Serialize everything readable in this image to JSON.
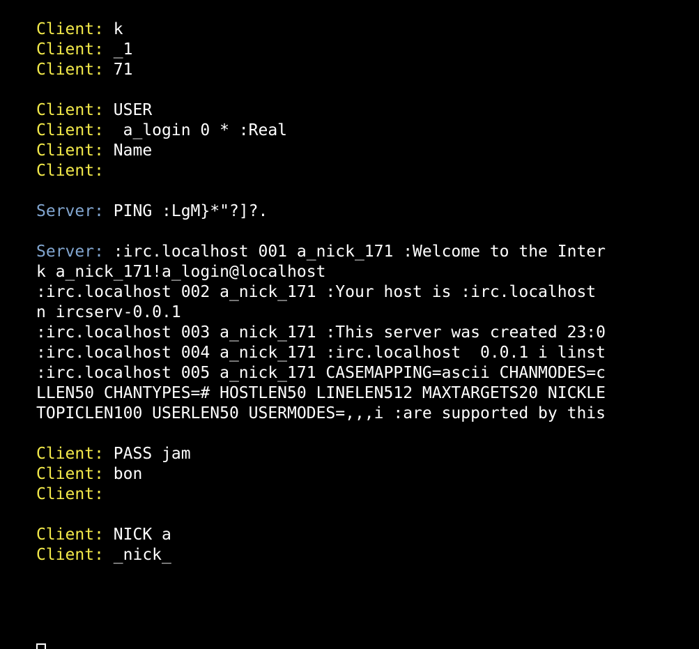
{
  "terminal": {
    "lines": [
      {
        "prefix": "Client:",
        "role": "client",
        "text": " k"
      },
      {
        "prefix": "Client:",
        "role": "client",
        "text": " _1"
      },
      {
        "prefix": "Client:",
        "role": "client",
        "text": " 71"
      },
      {
        "blank": true
      },
      {
        "prefix": "Client:",
        "role": "client",
        "text": " USER"
      },
      {
        "prefix": "Client:",
        "role": "client",
        "text": "  a_login 0 * :Real"
      },
      {
        "prefix": "Client:",
        "role": "client",
        "text": " Name"
      },
      {
        "prefix": "Client:",
        "role": "client",
        "text": ""
      },
      {
        "blank": true
      },
      {
        "prefix": "Server:",
        "role": "server",
        "text": " PING :LgM}*\"?]?."
      },
      {
        "blank": true
      },
      {
        "prefix": "Server:",
        "role": "server",
        "text": " :irc.localhost 001 a_nick_171 :Welcome to the Inter"
      },
      {
        "prefix": "",
        "role": "text",
        "text": "k a_nick_171!a_login@localhost"
      },
      {
        "prefix": "",
        "role": "text",
        "text": ":irc.localhost 002 a_nick_171 :Your host is :irc.localhost"
      },
      {
        "prefix": "",
        "role": "text",
        "text": "n ircserv-0.0.1"
      },
      {
        "prefix": "",
        "role": "text",
        "text": ":irc.localhost 003 a_nick_171 :This server was created 23:0"
      },
      {
        "prefix": "",
        "role": "text",
        "text": ":irc.localhost 004 a_nick_171 :irc.localhost  0.0.1 i linst"
      },
      {
        "prefix": "",
        "role": "text",
        "text": ":irc.localhost 005 a_nick_171 CASEMAPPING=ascii CHANMODES=c"
      },
      {
        "prefix": "",
        "role": "text",
        "text": "LLEN50 CHANTYPES=# HOSTLEN50 LINELEN512 MAXTARGETS20 NICKLE"
      },
      {
        "prefix": "",
        "role": "text",
        "text": "TOPICLEN100 USERLEN50 USERMODES=,,,i :are supported by this"
      },
      {
        "blank": true
      },
      {
        "prefix": "Client:",
        "role": "client",
        "text": " PASS jam"
      },
      {
        "prefix": "Client:",
        "role": "client",
        "text": " bon"
      },
      {
        "prefix": "Client:",
        "role": "client",
        "text": ""
      },
      {
        "blank": true
      },
      {
        "prefix": "Client:",
        "role": "client",
        "text": " NICK a"
      },
      {
        "prefix": "Client:",
        "role": "client",
        "text": " _nick_"
      }
    ]
  }
}
